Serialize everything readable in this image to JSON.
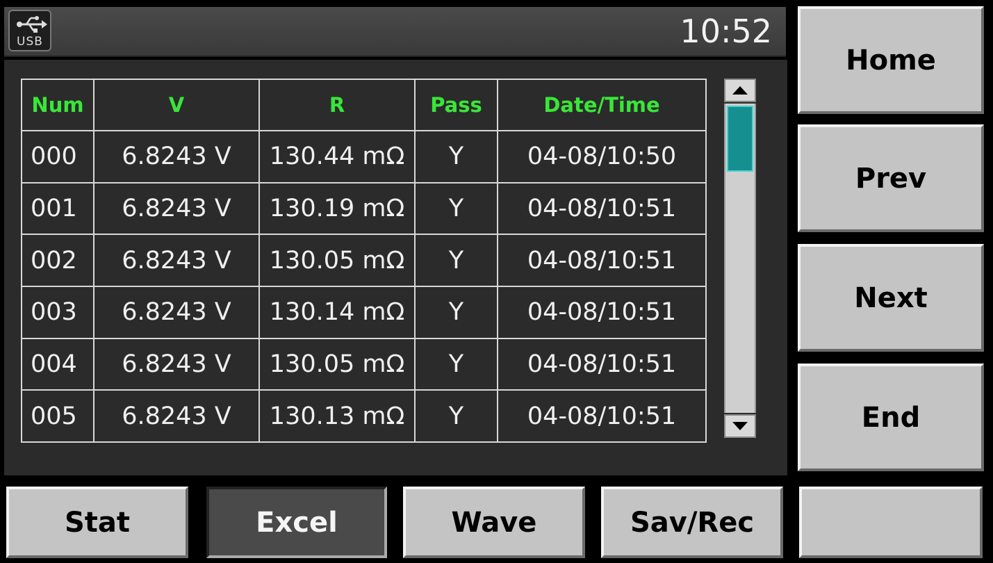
{
  "status_bar": {
    "usb_label": "USB",
    "clock": "10:52"
  },
  "table": {
    "headers": [
      "Num",
      "V",
      "R",
      "Pass",
      "Date/Time"
    ],
    "rows": [
      [
        "000",
        "6.8243 V",
        "130.44 mΩ",
        "Y",
        "04-08/10:50"
      ],
      [
        "001",
        "6.8243 V",
        "130.19 mΩ",
        "Y",
        "04-08/10:51"
      ],
      [
        "002",
        "6.8243 V",
        "130.05 mΩ",
        "Y",
        "04-08/10:51"
      ],
      [
        "003",
        "6.8243 V",
        "130.14 mΩ",
        "Y",
        "04-08/10:51"
      ],
      [
        "004",
        "6.8243 V",
        "130.05 mΩ",
        "Y",
        "04-08/10:51"
      ],
      [
        "005",
        "6.8243 V",
        "130.13 mΩ",
        "Y",
        "04-08/10:51"
      ]
    ]
  },
  "side_buttons": {
    "home": "Home",
    "prev": "Prev",
    "next": "Next",
    "end": "End",
    "blank": ""
  },
  "bottom_buttons": {
    "stat": "Stat",
    "excel": "Excel",
    "wave": "Wave",
    "sav_rec": "Sav/Rec"
  },
  "colors": {
    "header_text": "#39e639",
    "scroll_thumb": "#158f8f",
    "panel_bg": "#2b2b2b"
  }
}
